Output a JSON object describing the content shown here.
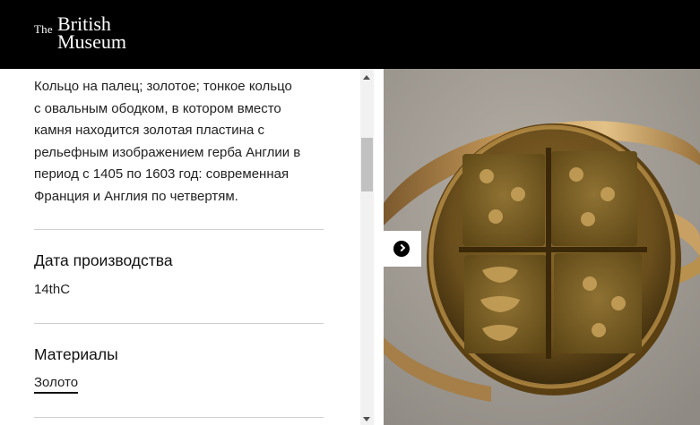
{
  "header": {
    "logo": {
      "the": "The",
      "british": "British",
      "museum": "Museum"
    }
  },
  "object": {
    "description_lines": [
      "Кольцо на палец; золотое; тонкое кольцо",
      "с овальным ободком, в котором вместо",
      "камня находится золотая пластина с",
      "рельефным изображением герба Англии в",
      "период с 1405 по 1603 год: современная",
      "Франция и Англия по четвертям."
    ],
    "production_date": {
      "title": "Дата производства",
      "value": "14thC"
    },
    "materials": {
      "title": "Материалы",
      "value": "Золото"
    }
  },
  "image": {
    "alt_icon": "gold-signet-ring-photo"
  },
  "controls": {
    "next_icon": "chevron-right-icon"
  },
  "colors": {
    "header_bg": "#000000",
    "divider": "#cfcfcf",
    "text": "#222222"
  }
}
